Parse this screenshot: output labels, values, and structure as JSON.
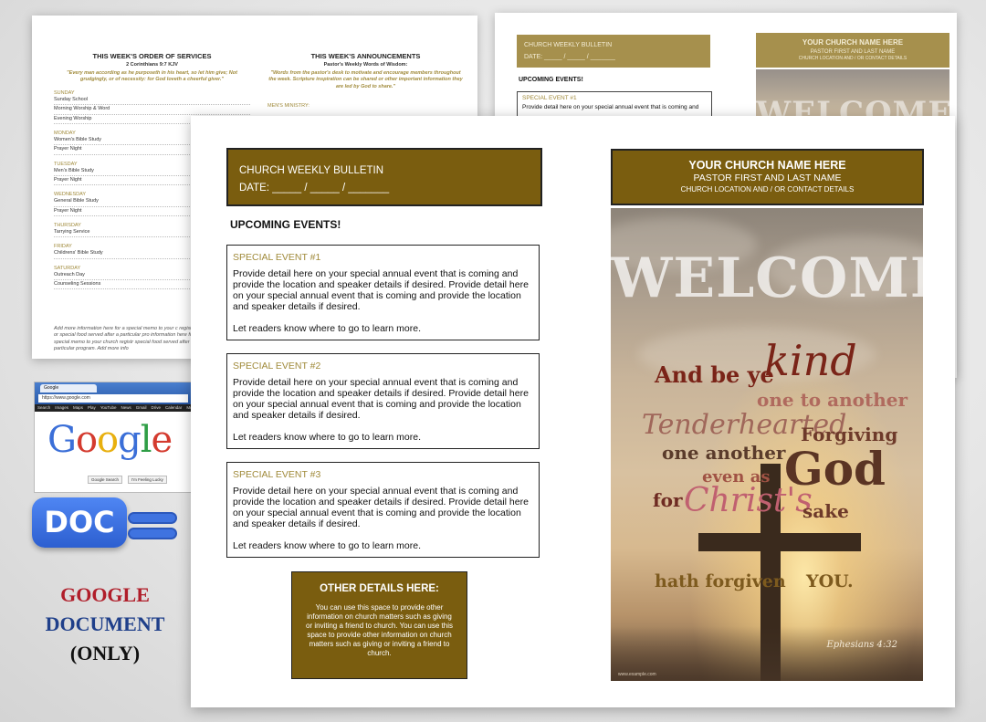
{
  "back_left": {
    "col1_title": "THIS WEEK'S ORDER OF SERVICES",
    "col1_ref": "2 Corinthians 9:7 KJV",
    "col1_quote": "\"Every man according as he purposeth in his heart, so let him give; Not grudgingly, or of necessity: for God loveth a cheerful giver.\"",
    "col2_title": "THIS WEEK'S ANNOUNCEMENTS",
    "col2_sub": "Pastor's Weekly Words of Wisdom:",
    "col2_quote": "\"Words from the pastor's desk to motivate and encourage members throughout the week. Scripture inspiration can be shared or other important information they are led by God to share.\"",
    "col2_ministry": "MEN'S MINISTRY:",
    "schedule": [
      {
        "day": "SUNDAY",
        "items": [
          "Sunday School",
          "Morning Worship & Word",
          "Evening Worship"
        ]
      },
      {
        "day": "MONDAY",
        "items": [
          "Women's Bible Study",
          "Prayer Night"
        ]
      },
      {
        "day": "TUESDAY",
        "items": [
          "Men's Bible Study",
          "Prayer Night"
        ]
      },
      {
        "day": "WEDNESDAY",
        "items": [
          "General Bible Study",
          "Prayer Night"
        ]
      },
      {
        "day": "THURSDAY",
        "items": [
          "Tarrying Service"
        ]
      },
      {
        "day": "FRIDAY",
        "items": [
          "Childrens' Bible Study"
        ]
      },
      {
        "day": "SATURDAY",
        "items": [
          "Outreach Day",
          "Counseling Sessions"
        ]
      }
    ],
    "note": "Add more information here for a special memo to your c registration or special food served after a particular pro information here for a special memo to your church registr special food served after a particular program. Add more info"
  },
  "back_right": {
    "bulletin_title": "CHURCH WEEKLY BULLETIN",
    "date_line": "DATE: _____ / _____ / _______",
    "church_name": "YOUR CHURCH NAME HERE",
    "pastor": "PASTOR FIRST AND LAST NAME",
    "location": "CHURCH LOCATION AND / OR CONTACT DETAILS",
    "upcoming": "UPCOMING EVENTS!",
    "event_title": "SPECIAL EVENT #1",
    "event_text": "Provide detail here on your special annual event that is coming and",
    "welcome": "WELCOME"
  },
  "badge": {
    "tab": "Google",
    "url": "https://www.google.com",
    "menu": [
      "Search",
      "Images",
      "Maps",
      "Play",
      "YouTube",
      "News",
      "Gmail",
      "Drive",
      "Calendar",
      "More"
    ],
    "logo_letters": [
      {
        "ch": "G",
        "color": "#3b6fd8"
      },
      {
        "ch": "o",
        "color": "#d43b2f"
      },
      {
        "ch": "o",
        "color": "#e8b00f"
      },
      {
        "ch": "g",
        "color": "#3b6fd8"
      },
      {
        "ch": "l",
        "color": "#2f9e46"
      },
      {
        "ch": "e",
        "color": "#d43b2f"
      }
    ],
    "btn_search": "Google Search",
    "btn_lucky": "I'm Feeling Lucky",
    "doc": "DOC",
    "label_line1": "GOOGLE",
    "label_line2": "DOCUMENT",
    "label_line3": "(ONLY)",
    "label_colors": {
      "google": "#b01e2a",
      "document": "#1f3f8a",
      "only": "#111111"
    }
  },
  "front": {
    "bulletin_title": "CHURCH WEEKLY BULLETIN",
    "date_line": "DATE: _____ / _____ / _______",
    "upcoming": "UPCOMING EVENTS!",
    "events": [
      {
        "title": "SPECIAL EVENT #1",
        "body": "Provide detail here on your special annual event that is coming and provide the location and speaker details if desired. Provide detail here on your special annual event that is coming and provide the location and speaker details if desired.",
        "more": "Let readers know where to go to learn more."
      },
      {
        "title": "SPECIAL EVENT #2",
        "body": "Provide detail here on your special annual event that is coming and provide the location and speaker details if desired. Provide detail here on your special annual event that is coming and provide the location and speaker details if desired.",
        "more": "Let readers know where to go to learn more."
      },
      {
        "title": "SPECIAL EVENT #3",
        "body": "Provide detail here on your special annual event that is coming and provide the location and speaker details if desired. Provide detail here on your special annual event that is coming and provide the location and speaker details if desired.",
        "more": "Let readers know where to go to learn more."
      }
    ],
    "other_title": "OTHER DETAILS HERE:",
    "other_body": "You can use this space to provide other information on church matters such as giving or inviting a friend to church. You can use this space to provide other information on church matters such as giving or inviting a friend to church.",
    "church_name": "YOUR CHURCH NAME HERE",
    "pastor": "PASTOR FIRST AND LAST NAME",
    "location": "CHURCH LOCATION AND / OR CONTACT DETAILS",
    "accent_color": "#7a5d0f",
    "poster": {
      "welcome": "WELCOME",
      "w_and_be_ye": "And be ye",
      "w_kind": "kind",
      "w_one_to_another": "one to another",
      "w_tenderhearted": "Tenderhearted",
      "w_forgiving": "Forgiving",
      "w_one_another": "one another",
      "w_even_as": "even as",
      "w_god": "God",
      "w_for": "for",
      "w_christs": "Christ's",
      "w_sake": "sake",
      "w_hath_forgiven": "hath forgiven",
      "w_you": "YOU.",
      "reference": "Ephesians 4:32",
      "credit": "www.example.com"
    }
  }
}
